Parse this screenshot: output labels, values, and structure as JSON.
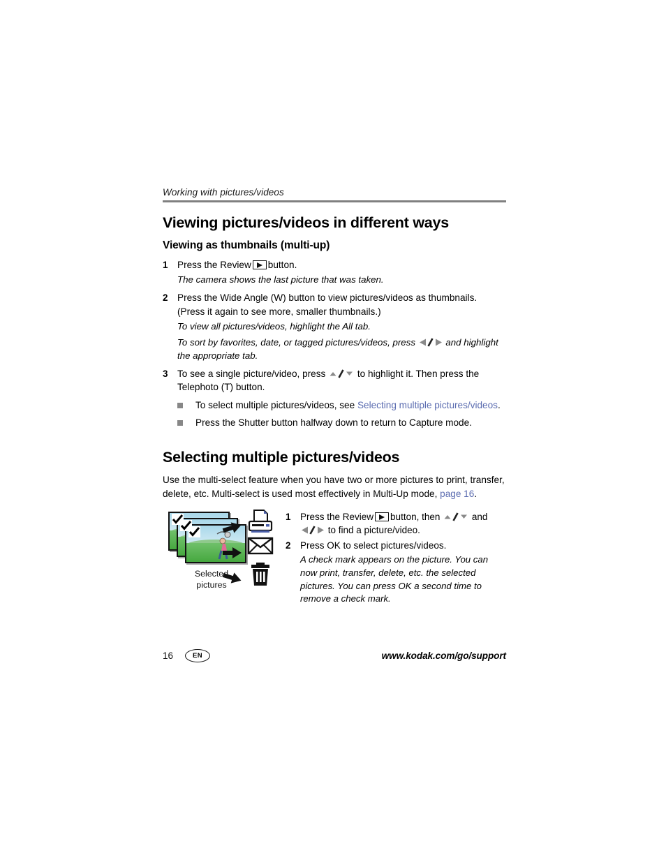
{
  "header": {
    "running_head": "Working with pictures/videos"
  },
  "section1": {
    "title": "Viewing pictures/videos in different ways",
    "subtitle": "Viewing as thumbnails (multi-up)",
    "steps": [
      {
        "num": "1",
        "text_before": "Press the Review",
        "icon": "review-button-icon",
        "text_after": "button.",
        "note": "The camera shows the last picture that was taken."
      },
      {
        "num": "2",
        "text": "Press the Wide Angle (W) button to view pictures/videos as thumbnails. (Press it again to see more, smaller thumbnails.)",
        "note_line1": "To view all pictures/videos, highlight the All tab.",
        "note_line2_before": "To sort by favorites, date, or tagged pictures/videos, press",
        "note_icon": "left-right-arrows-icon",
        "note_line2_after": "and highlight the appropriate tab."
      },
      {
        "num": "3",
        "text_before": "To see a single picture/video, press",
        "icon": "up-down-arrows-icon",
        "text_after": "to highlight it. Then press the Telephoto (T) button."
      }
    ],
    "bullets": [
      {
        "text_before": "To select multiple pictures/videos, see",
        "link": "Selecting multiple pictures/videos",
        "text_after": "."
      },
      {
        "text_before": "Press the Shutter button halfway down to return to Capture mode.",
        "link": "",
        "text_after": ""
      }
    ]
  },
  "section2": {
    "title": "Selecting multiple pictures/videos",
    "intro_before": "Use the multi-select feature when you have two or more pictures to print, transfer, delete, etc. Multi-select is used most effectively in Multi-Up mode,",
    "intro_link": "page 16",
    "intro_after": ".",
    "figure": {
      "caption_line1": "Selected",
      "caption_line2": "pictures",
      "thumbnail_count": 3,
      "check_icon": "check-mark-icon",
      "arrows": [
        "arrow-up-right-icon",
        "arrow-right-icon",
        "arrow-down-right-icon"
      ],
      "destinations": [
        "printer-icon",
        "envelope-icon",
        "trash-icon"
      ]
    },
    "steps": [
      {
        "num": "1",
        "text_before": "Press the Review",
        "icon": "review-button-icon",
        "text_mid": "button, then",
        "icon2": "up-down-arrows-icon",
        "text_and": "and",
        "icon3": "left-right-arrows-icon",
        "text_after": "to find a picture/video."
      },
      {
        "num": "2",
        "text": "Press OK to select pictures/videos.",
        "note": "A check mark appears on the picture. You can now print, transfer, delete, etc. the selected pictures. You can press OK a second time to remove a check mark."
      }
    ]
  },
  "footer": {
    "page_number": "16",
    "language_badge": "EN",
    "url": "www.kodak.com/go/support"
  },
  "colors": {
    "link": "#5b6cb0",
    "rule": "#808080",
    "bullet": "#878787",
    "arrow_glyph": "#8a8a8a"
  }
}
